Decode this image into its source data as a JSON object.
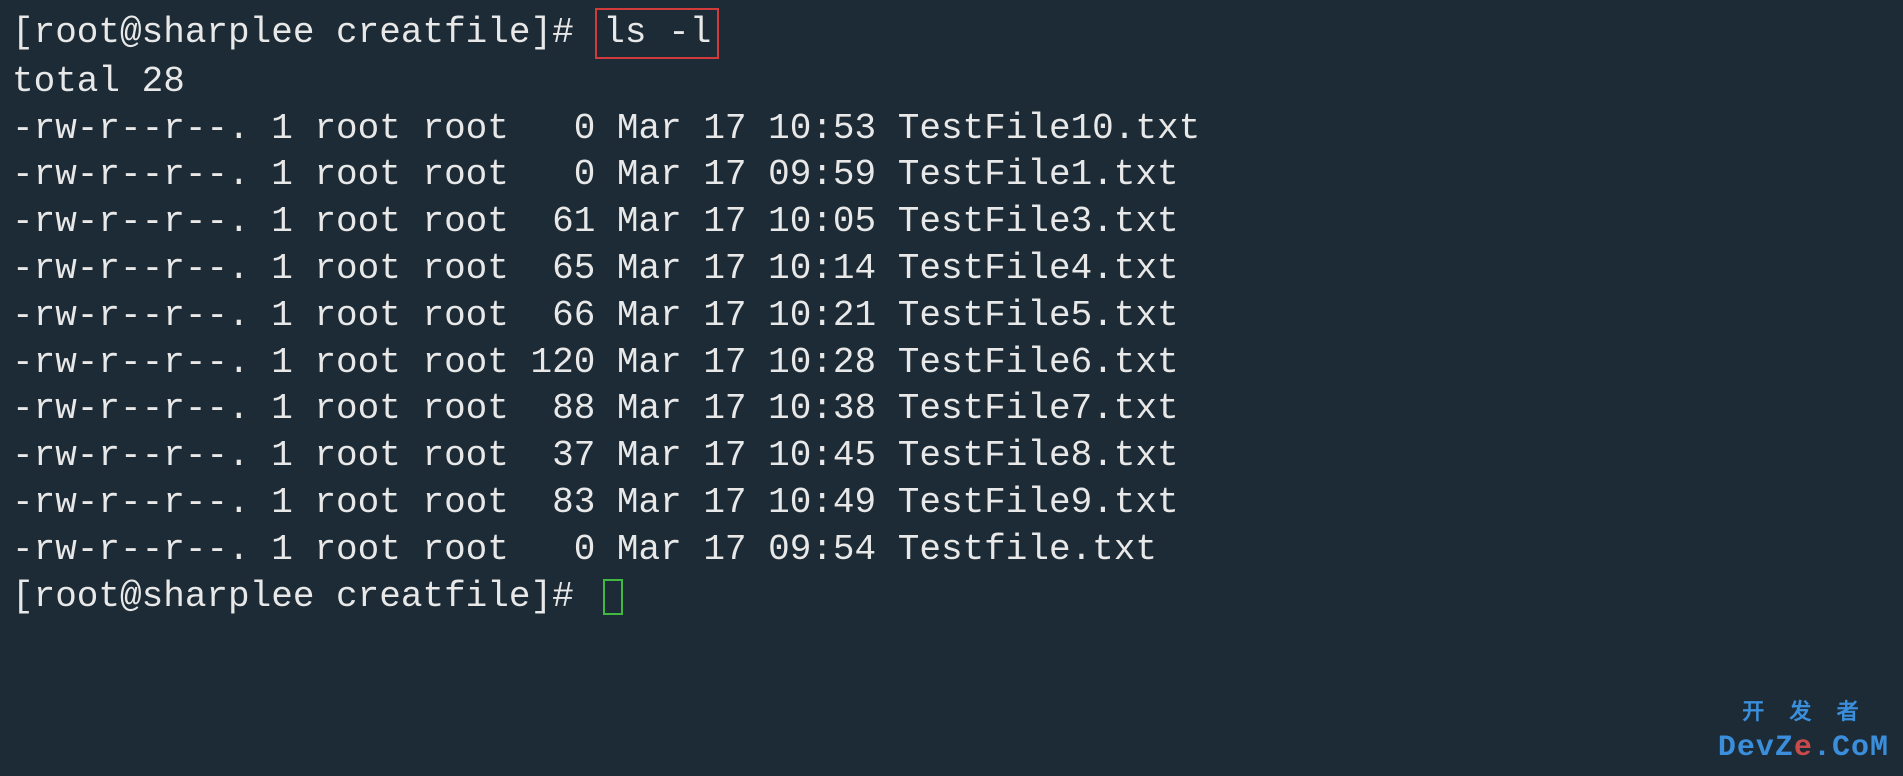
{
  "prompt1": {
    "text": "[root@sharplee creatfile]# ",
    "command": "ls -l"
  },
  "total_line": "total 28",
  "files": [
    {
      "perms": "-rw-r--r--.",
      "links": "1",
      "owner": "root",
      "group": "root",
      "size": "  0",
      "month": "Mar",
      "day": "17",
      "time": "10:53",
      "name": "TestFile10.txt"
    },
    {
      "perms": "-rw-r--r--.",
      "links": "1",
      "owner": "root",
      "group": "root",
      "size": "  0",
      "month": "Mar",
      "day": "17",
      "time": "09:59",
      "name": "TestFile1.txt"
    },
    {
      "perms": "-rw-r--r--.",
      "links": "1",
      "owner": "root",
      "group": "root",
      "size": " 61",
      "month": "Mar",
      "day": "17",
      "time": "10:05",
      "name": "TestFile3.txt"
    },
    {
      "perms": "-rw-r--r--.",
      "links": "1",
      "owner": "root",
      "group": "root",
      "size": " 65",
      "month": "Mar",
      "day": "17",
      "time": "10:14",
      "name": "TestFile4.txt"
    },
    {
      "perms": "-rw-r--r--.",
      "links": "1",
      "owner": "root",
      "group": "root",
      "size": " 66",
      "month": "Mar",
      "day": "17",
      "time": "10:21",
      "name": "TestFile5.txt"
    },
    {
      "perms": "-rw-r--r--.",
      "links": "1",
      "owner": "root",
      "group": "root",
      "size": "120",
      "month": "Mar",
      "day": "17",
      "time": "10:28",
      "name": "TestFile6.txt"
    },
    {
      "perms": "-rw-r--r--.",
      "links": "1",
      "owner": "root",
      "group": "root",
      "size": " 88",
      "month": "Mar",
      "day": "17",
      "time": "10:38",
      "name": "TestFile7.txt"
    },
    {
      "perms": "-rw-r--r--.",
      "links": "1",
      "owner": "root",
      "group": "root",
      "size": " 37",
      "month": "Mar",
      "day": "17",
      "time": "10:45",
      "name": "TestFile8.txt"
    },
    {
      "perms": "-rw-r--r--.",
      "links": "1",
      "owner": "root",
      "group": "root",
      "size": " 83",
      "month": "Mar",
      "day": "17",
      "time": "10:49",
      "name": "TestFile9.txt"
    },
    {
      "perms": "-rw-r--r--.",
      "links": "1",
      "owner": "root",
      "group": "root",
      "size": "  0",
      "month": "Mar",
      "day": "17",
      "time": "09:54",
      "name": "Testfile.txt"
    }
  ],
  "prompt2": {
    "text": "[root@sharplee creatfile]# "
  },
  "watermark": {
    "top": "开 发 者",
    "bottom": "DevZe.CoM"
  }
}
